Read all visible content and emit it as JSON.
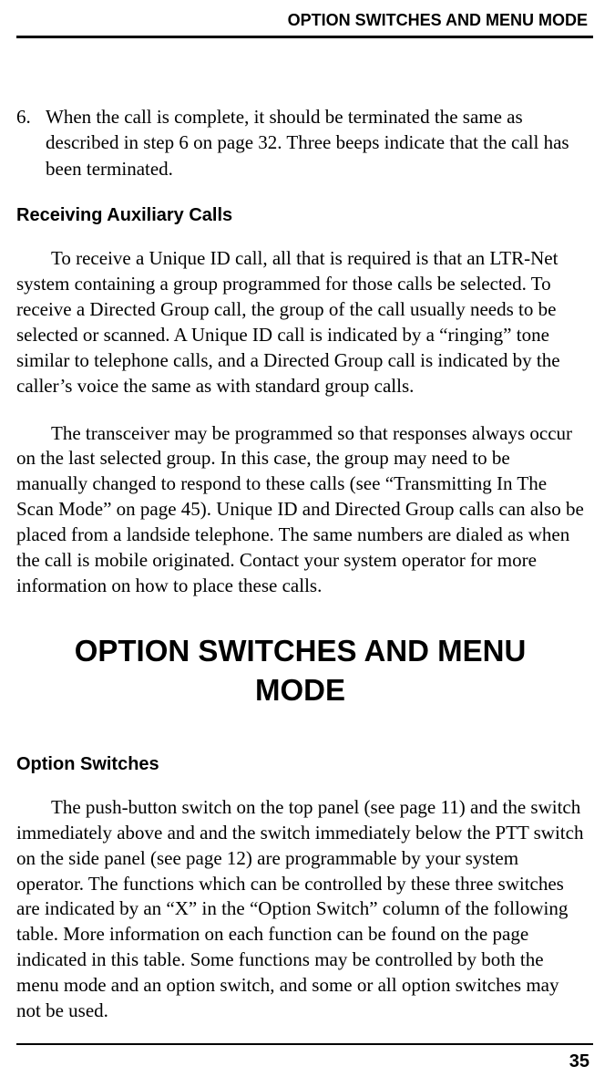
{
  "header": {
    "running_title": "OPTION SWITCHES AND MENU MODE"
  },
  "list_item_6": {
    "marker": "6.",
    "text": "When the call is complete, it should be terminated the same as described in step 6 on page 32. Three beeps indicate that the call has been terminated."
  },
  "receiving_aux": {
    "heading": "Receiving Auxiliary Calls",
    "para1": "To receive a Unique ID call, all that is required is that an LTR-Net system containing a group programmed for those calls be selected. To receive a Directed Group call, the group of the call usually needs to be selected or scanned. A Unique ID call is indicated by a “ringing” tone similar to telephone calls, and a Directed Group call is indicated by the caller’s voice the same as with standard group calls.",
    "para2": "The transceiver may be programmed so that responses always occur on the last selected group. In this case, the group may need to be manually changed to respond to these calls (see “Transmitting In The Scan Mode” on page 45). Unique ID and Directed Group calls can also be placed from a landside telephone. The same numbers are dialed as when the call is mobile originated. Contact your system operator for more information on how to place these calls."
  },
  "section": {
    "title": "OPTION SWITCHES AND MENU MODE"
  },
  "option_switches": {
    "heading": "Option Switches",
    "para1": "The push-button switch on the top panel (see page 11) and the switch immediately above and and the switch immediately below the PTT switch on the side panel (see page 12) are programmable by your system operator. The functions which can be controlled by these three switches are indicated by an “X” in the “Option Switch” column of the following table. More information on each function can be found on the page indicated in this table. Some functions may be controlled by both the menu mode and an option switch, and some or all option switches may not be used."
  },
  "page_number": "35"
}
